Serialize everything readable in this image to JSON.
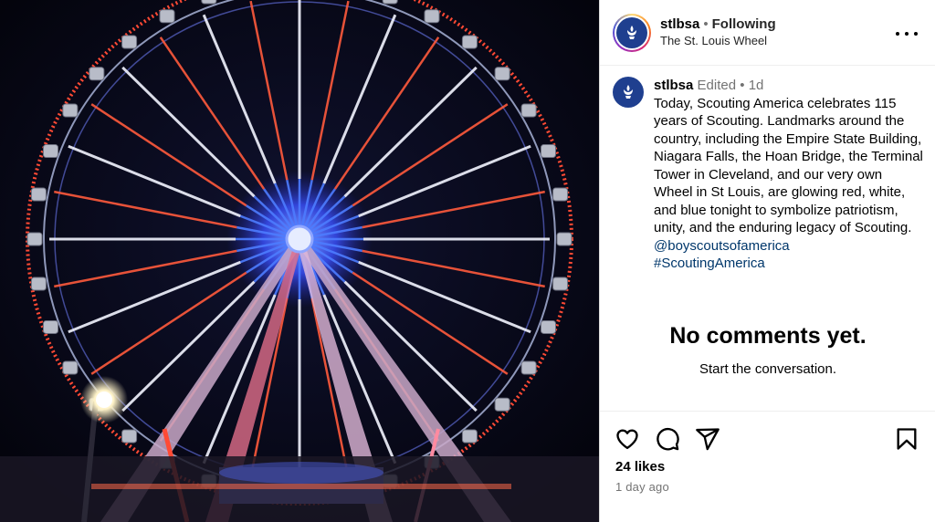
{
  "post": {
    "media": {
      "alt_icon": "ferris-wheel-photo"
    },
    "header": {
      "username": "stlbsa",
      "separator": "•",
      "follow_status": "Following",
      "location": "The St. Louis Wheel"
    },
    "caption": {
      "username": "stlbsa",
      "edited": "Edited",
      "separator": "•",
      "age": "1d",
      "text": "Today, Scouting America celebrates 115 years of Scouting. Landmarks around the country, including the Empire State Building, Niagara Falls, the Hoan Bridge, the Terminal Tower in Cleveland, and our very own Wheel in St Louis, are glowing red, white, and blue tonight to symbolize patriotism, unity, and the enduring legacy of Scouting.",
      "mention": "@boyscoutsofamerica",
      "hashtag": "#ScoutingAmerica"
    },
    "comments": {
      "empty_title": "No comments yet.",
      "empty_subtitle": "Start the conversation."
    },
    "footer": {
      "likes": "24 likes",
      "time": "1 day ago"
    },
    "icons": [
      "more-icon",
      "heart-icon",
      "comment-icon",
      "share-icon",
      "bookmark-icon"
    ],
    "colors": {
      "link": "#00376b",
      "muted": "#737373",
      "avatar": "#1f3f8f"
    }
  }
}
